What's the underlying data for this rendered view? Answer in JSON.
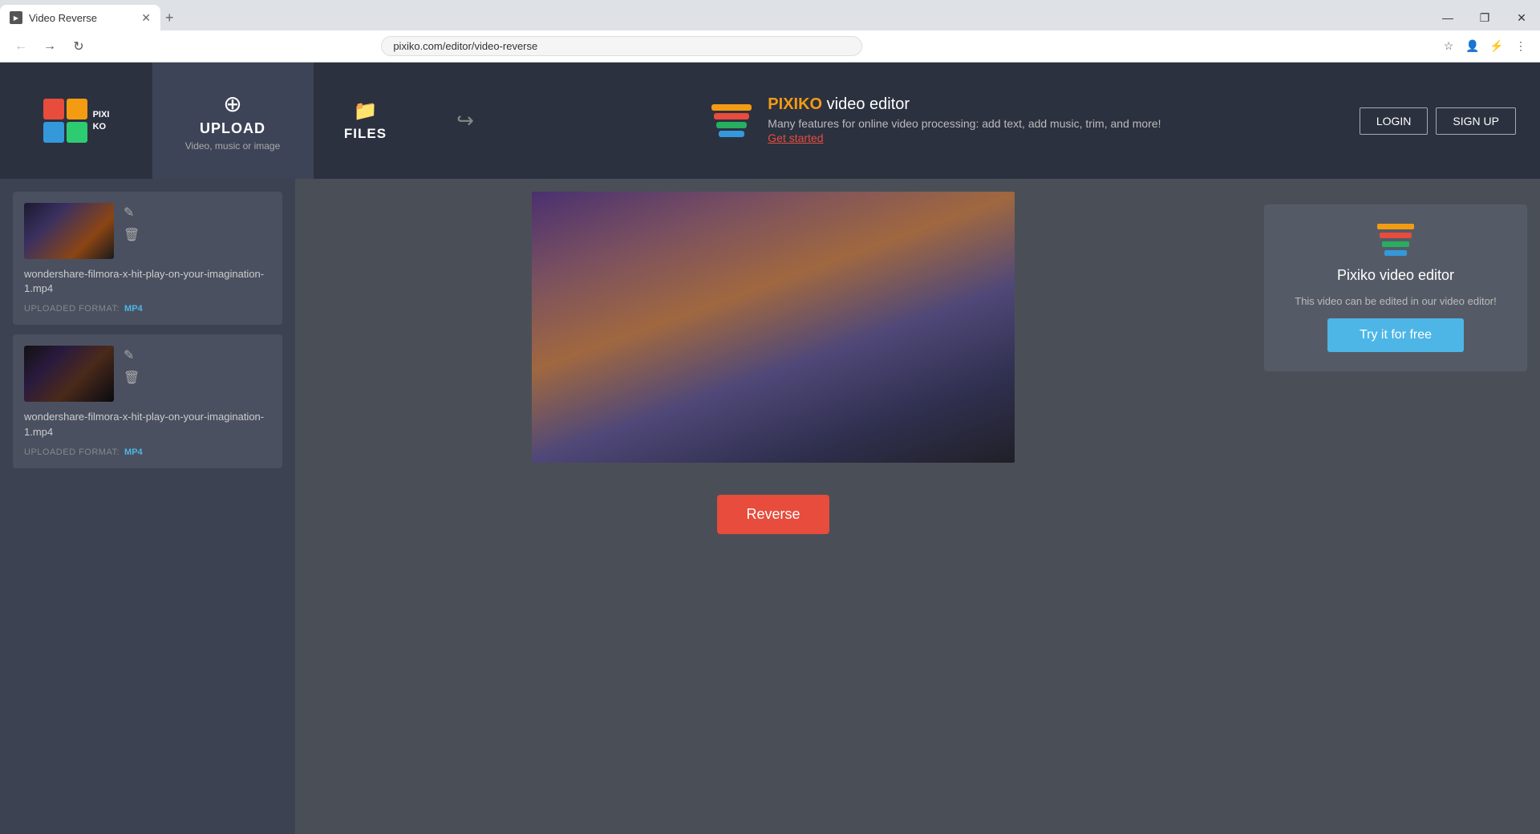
{
  "browser": {
    "tab_title": "Video Reverse",
    "url": "pixiko.com/editor/video-reverse",
    "new_tab_label": "+",
    "win_minimize": "—",
    "win_restore": "❐",
    "win_close": "✕"
  },
  "header": {
    "logo_text": "PIXI\nKO",
    "upload_label": "UPLOAD",
    "upload_sub": "Video, music\nor image",
    "files_label": "FILES",
    "promo": {
      "title_brand": "PIXIKO",
      "title_rest": " video editor",
      "description": "Many features for online video processing: add text, add music, trim, and more!",
      "link_text": "Get started"
    },
    "login_label": "LOGIN",
    "signup_label": "SIGN UP"
  },
  "sidebar": {
    "cards": [
      {
        "filename": "wondershare-filmora-x-hit-play-on-your-imagination-1.mp4",
        "format_label": "UPLOADED FORMAT:",
        "format_value": "MP4"
      },
      {
        "filename": "wondershare-filmora-x-hit-play-on-your-imagination-1.mp4",
        "format_label": "UPLOADED FORMAT:",
        "format_value": "MP4"
      }
    ]
  },
  "video": {
    "reverse_button": "Reverse"
  },
  "editor_promo": {
    "title": "Pixiko video editor",
    "description": "This video can be edited in our video editor!",
    "cta_button": "Try it for free"
  }
}
